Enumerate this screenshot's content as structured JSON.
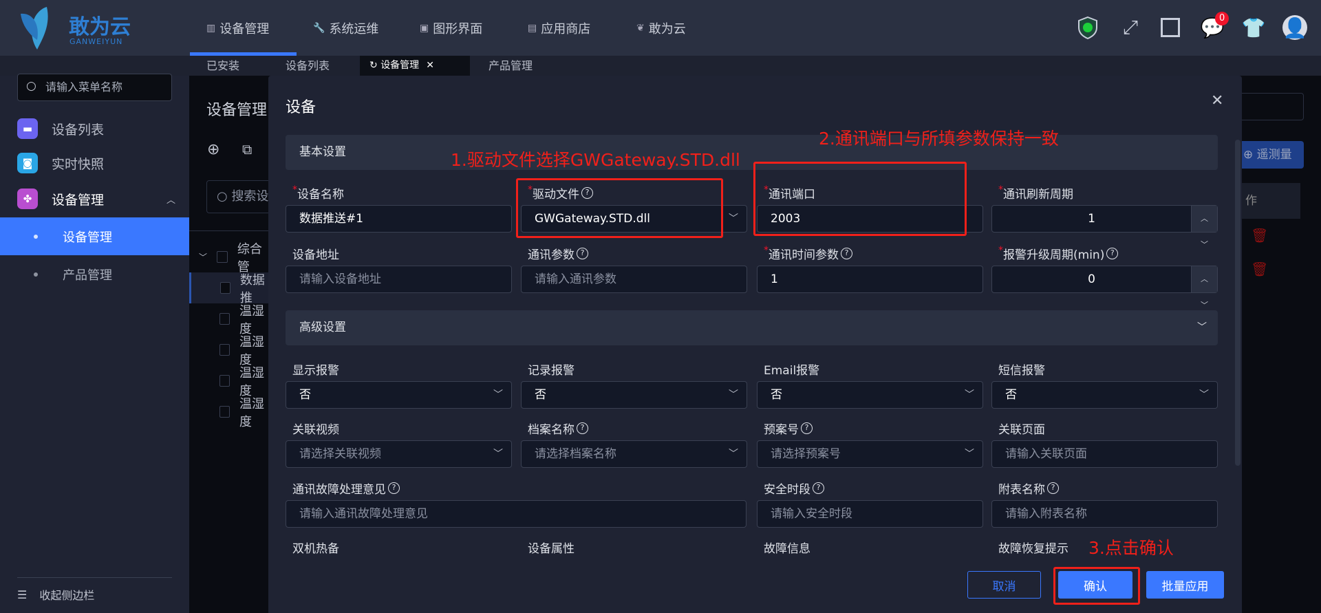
{
  "colors": {
    "accent": "#3a78ff",
    "annotation": "#f0201a",
    "badge": "#f0142a"
  },
  "header": {
    "logo": "敢为云",
    "logo_sub": "GANWEIYUN",
    "nav": [
      {
        "label": "设备管理",
        "icon": "device-icon"
      },
      {
        "label": "系统运维",
        "icon": "wrench-icon"
      },
      {
        "label": "图形界面",
        "icon": "monitor-icon"
      },
      {
        "label": "应用商店",
        "icon": "store-icon"
      },
      {
        "label": "敢为云",
        "icon": "butterfly-icon"
      }
    ],
    "message_count": "0"
  },
  "tabs": [
    "已安装",
    "设备列表",
    "设备管理",
    "产品管理"
  ],
  "sidebar": {
    "search_placeholder": "请输入菜单名称",
    "items": [
      "设备列表",
      "实时快照",
      "设备管理"
    ],
    "subitems": [
      "设备管理",
      "产品管理"
    ],
    "collapse": "收起侧边栏"
  },
  "background": {
    "title": "设备管理",
    "search_placeholder": "搜索设",
    "tree_root": "综合管",
    "rows": [
      "数据推",
      "温湿度",
      "温湿度",
      "温湿度",
      "温湿度"
    ],
    "telemetry_button": "遥测量",
    "col_header": "作"
  },
  "dialog": {
    "title": "设备",
    "basic_section": "基本设置",
    "advanced_section": "高级设置",
    "basic": [
      {
        "label": "设备名称",
        "required": true,
        "value": "数据推送#1"
      },
      {
        "label": "驱动文件",
        "required": true,
        "help": true,
        "value": "GWGateway.STD.dll",
        "select": true
      },
      {
        "label": "通讯端口",
        "required": true,
        "value": "2003"
      },
      {
        "label": "通讯刷新周期",
        "required": true,
        "value": "1",
        "number": true
      },
      {
        "label": "设备地址",
        "placeholder": "请输入设备地址"
      },
      {
        "label": "通讯参数",
        "help": true,
        "placeholder": "请输入通讯参数"
      },
      {
        "label": "通讯时间参数",
        "required": true,
        "help": true,
        "value": "1"
      },
      {
        "label": "报警升级周期(min)",
        "required": true,
        "help": true,
        "value": "0",
        "number": true
      }
    ],
    "advanced": [
      {
        "label": "显示报警",
        "value": "否",
        "select": true
      },
      {
        "label": "记录报警",
        "value": "否",
        "select": true
      },
      {
        "label": "Email报警",
        "value": "否",
        "select": true
      },
      {
        "label": "短信报警",
        "value": "否",
        "select": true
      },
      {
        "label": "关联视频",
        "placeholder": "请选择关联视频",
        "select": true
      },
      {
        "label": "档案名称",
        "help": true,
        "placeholder": "请选择档案名称",
        "select": true
      },
      {
        "label": "预案号",
        "help": true,
        "placeholder": "请选择预案号",
        "select": true
      },
      {
        "label": "关联页面",
        "placeholder": "请输入关联页面"
      },
      {
        "label": "通讯故障处理意见",
        "help": true,
        "placeholder": "请输入通讯故障处理意见",
        "wide": true
      },
      {
        "label": "安全时段",
        "help": true,
        "placeholder": "请输入安全时段"
      },
      {
        "label": "附表名称",
        "help": true,
        "placeholder": "请输入附表名称"
      }
    ],
    "more_labels": [
      "双机热备",
      "设备属性",
      "故障信息",
      "故障恢复提示"
    ],
    "cancel": "取消",
    "confirm": "确认",
    "batch": "批量应用"
  },
  "annotations": [
    "1.驱动文件选择GWGateway.STD.dll",
    "2.通讯端口与所填参数保持一致",
    "3.点击确认"
  ]
}
